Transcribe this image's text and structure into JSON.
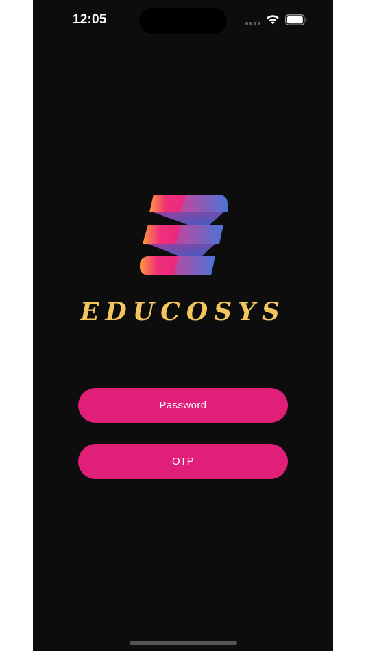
{
  "status_bar": {
    "time": "12:05",
    "icons": [
      "cellular-signal-icon",
      "wifi-icon",
      "battery-icon"
    ]
  },
  "brand": {
    "logo_icon": "educosys-logo-icon",
    "name": "EDUCOSYS",
    "name_color": "#f2c55e"
  },
  "login_options": {
    "password_label": "Password",
    "otp_label": "OTP",
    "button_color": "#df1f78"
  },
  "colors": {
    "background": "#0d0d0d",
    "text": "#ffffff"
  }
}
